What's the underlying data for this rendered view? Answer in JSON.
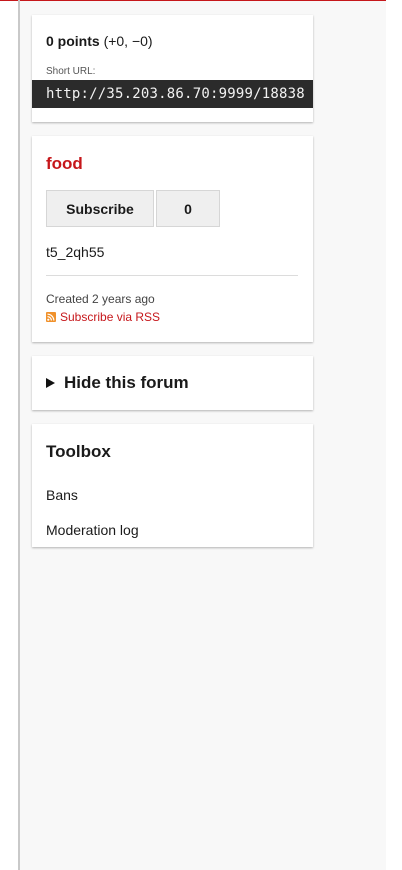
{
  "points": {
    "value": "0 points",
    "breakdown": "(+0, −0)"
  },
  "short_url": {
    "label": "Short URL:",
    "value": "http://35.203.86.70:9999/18838"
  },
  "forum": {
    "name": "food",
    "subscribe_label": "Subscribe",
    "subscriber_count": "0",
    "id": "t5_2qh55",
    "created": "Created 2 years ago",
    "rss_label": "Subscribe via RSS"
  },
  "hide_forum": {
    "label": "Hide this forum"
  },
  "toolbox": {
    "title": "Toolbox",
    "links": [
      {
        "label": "Bans"
      },
      {
        "label": "Moderation log"
      }
    ]
  },
  "colors": {
    "accent": "#c6171b",
    "sidebar_bg": "#f8f8f8",
    "url_box_bg": "#2b2b2b",
    "rss_orange": "#f0912b"
  },
  "icons": [
    "rss-icon",
    "disclosure-triangle-icon"
  ]
}
